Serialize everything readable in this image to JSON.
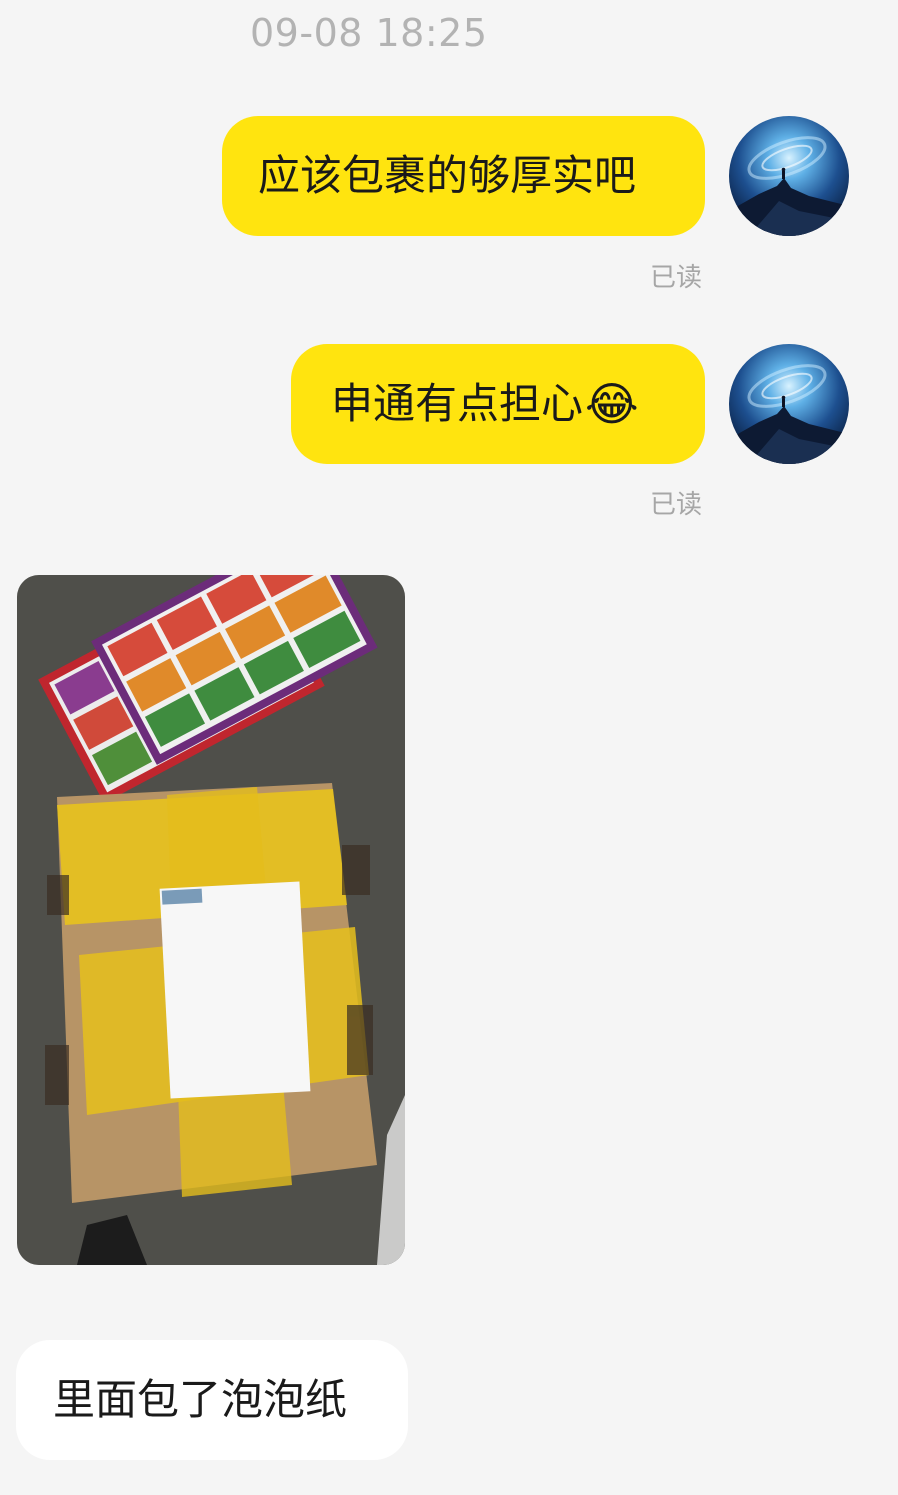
{
  "chat": {
    "timestamp": "09-08 18:25",
    "messages": [
      {
        "direction": "out",
        "text": "应该包裹的够厚实吧",
        "status": "已读"
      },
      {
        "direction": "out",
        "text": "申通有点担心",
        "emoji": "😂",
        "status": "已读"
      },
      {
        "direction": "in",
        "type": "image",
        "description_visible": "package photo"
      },
      {
        "direction": "in",
        "text": "里面包了泡泡纸"
      }
    ]
  },
  "colors": {
    "background": "#f5f5f5",
    "outgoing_bubble": "#ffe40f",
    "incoming_bubble": "#ffffff",
    "read_text": "#a6a6a6",
    "timestamp_text": "#b3b3b3"
  },
  "icons": {
    "avatar": "galaxy-avatar"
  }
}
